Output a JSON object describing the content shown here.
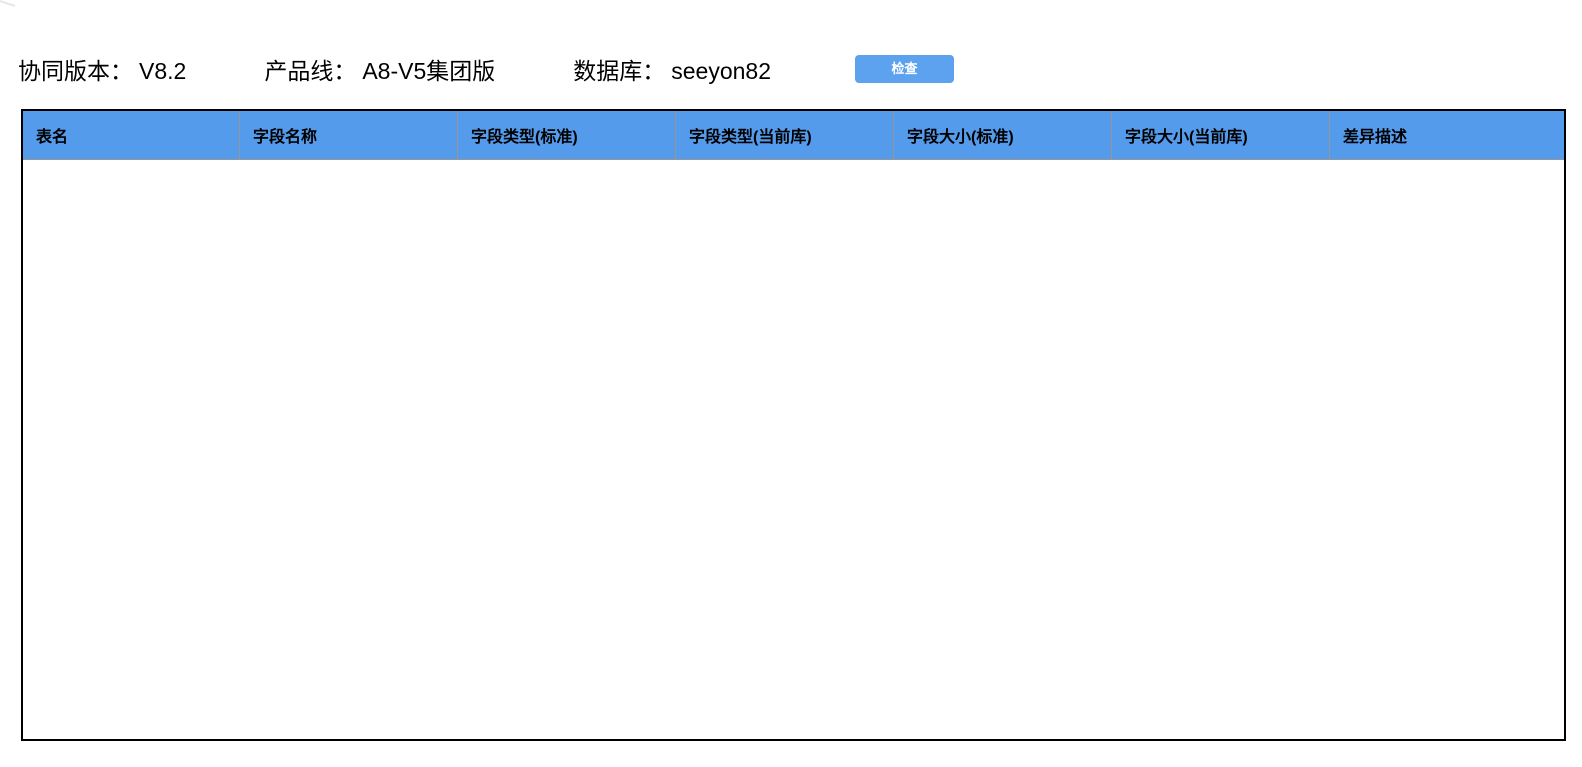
{
  "toolbar": {
    "fields": [
      {
        "label": "协同版本：",
        "value": "V8.2"
      },
      {
        "label": "产品线：",
        "value": "A8-V5集团版"
      },
      {
        "label": "数据库：",
        "value": "seeyon82"
      }
    ],
    "check_button": "检查"
  },
  "table": {
    "columns": [
      "表名",
      "字段名称",
      "字段类型(标准)",
      "字段类型(当前库)",
      "字段大小(标准)",
      "字段大小(当前库)",
      "差异描述"
    ],
    "rows": []
  },
  "colors": {
    "header_cell_bg": "#549BEC",
    "button_bg": "#5CA2EF",
    "button_text": "#FFFFFF",
    "outer_border": "#000000",
    "cell_divider": "#969696",
    "header_text": "#000000"
  }
}
